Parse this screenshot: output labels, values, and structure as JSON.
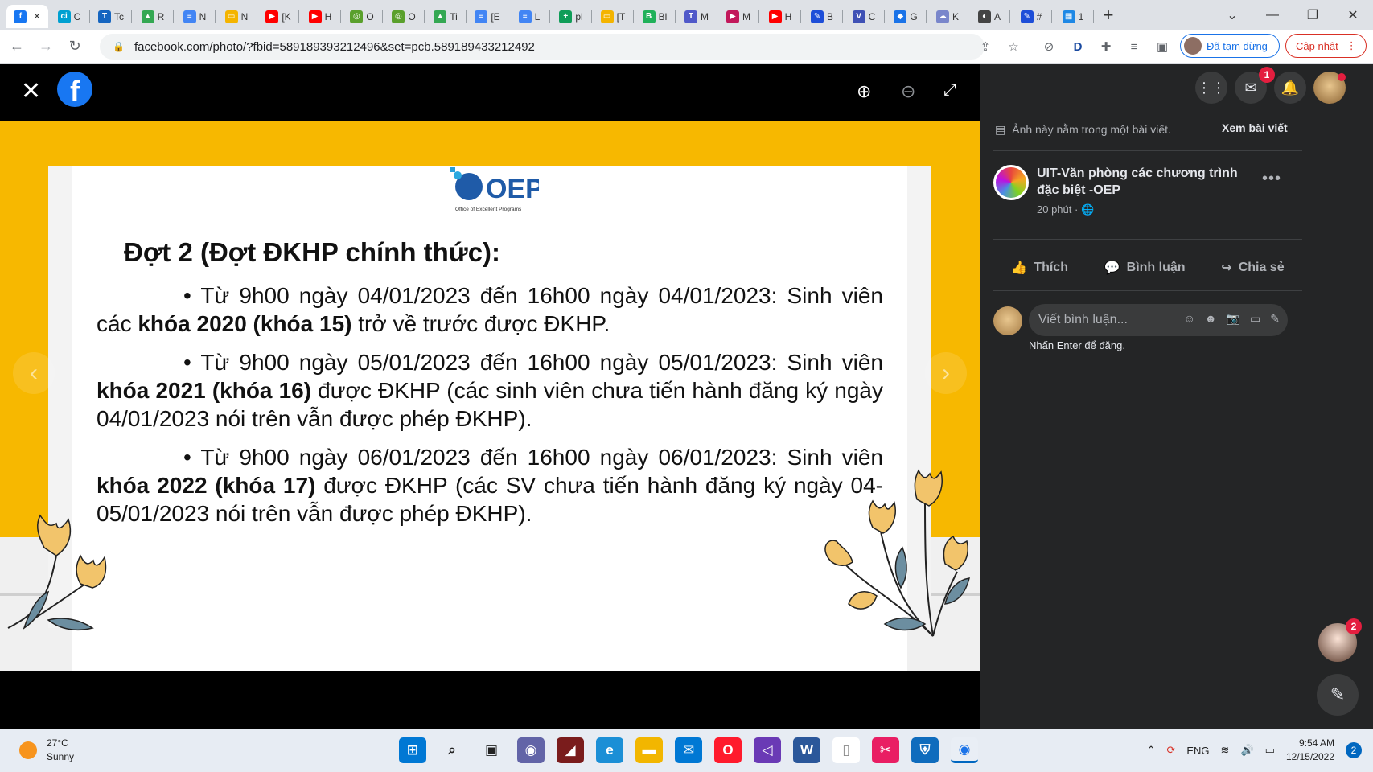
{
  "browser": {
    "tabs": [
      {
        "label": "",
        "color": "#1877f2",
        "glyph": "f",
        "active": true
      },
      {
        "label": "C",
        "color": "#00a0d1",
        "glyph": "ci"
      },
      {
        "label": "Tc",
        "color": "#1565c0",
        "glyph": "T"
      },
      {
        "label": "R",
        "color": "#34a853",
        "glyph": "▲"
      },
      {
        "label": "N",
        "color": "#4285f4",
        "glyph": "≡"
      },
      {
        "label": "N",
        "color": "#f4b400",
        "glyph": "▭"
      },
      {
        "label": "[K",
        "color": "#ff0000",
        "glyph": "▶"
      },
      {
        "label": "H",
        "color": "#ff0000",
        "glyph": "▶"
      },
      {
        "label": "O",
        "color": "#5aa02c",
        "glyph": "◎"
      },
      {
        "label": "O",
        "color": "#5aa02c",
        "glyph": "◎"
      },
      {
        "label": "Ti",
        "color": "#34a853",
        "glyph": "▲"
      },
      {
        "label": "[E",
        "color": "#4285f4",
        "glyph": "≡"
      },
      {
        "label": "L",
        "color": "#4285f4",
        "glyph": "≡"
      },
      {
        "label": "pl",
        "color": "#0f9d58",
        "glyph": "+"
      },
      {
        "label": "[T",
        "color": "#f4b400",
        "glyph": "▭"
      },
      {
        "label": "Bl",
        "color": "#20b15a",
        "glyph": "B"
      },
      {
        "label": "M",
        "color": "#5059c9",
        "glyph": "T"
      },
      {
        "label": "M",
        "color": "#c2185b",
        "glyph": "▶"
      },
      {
        "label": "H",
        "color": "#ff0000",
        "glyph": "▶"
      },
      {
        "label": "B",
        "color": "#1d4ed8",
        "glyph": "✎"
      },
      {
        "label": "C",
        "color": "#3f51b5",
        "glyph": "V"
      },
      {
        "label": "G",
        "color": "#1a73e8",
        "glyph": "◆"
      },
      {
        "label": "K",
        "color": "#7986cb",
        "glyph": "☁"
      },
      {
        "label": "A",
        "color": "#444444",
        "glyph": "◐"
      },
      {
        "label": "#",
        "color": "#1d4ed8",
        "glyph": "✎"
      },
      {
        "label": "1",
        "color": "#1e88e5",
        "glyph": "▦"
      }
    ],
    "new_tab": "+",
    "url": "facebook.com/photo/?fbid=589189393212496&set=pcb.589189433212492",
    "profile_status": "Đã tạm dừng",
    "update_label": "Cập nhật"
  },
  "slide": {
    "logo_text": "OEP",
    "logo_sub": "Office of Excellent Programs",
    "heading": "Đợt 2 (Đợt ĐKHP chính thức):",
    "items": [
      {
        "bullet": "•",
        "pre": " Từ 9h00 ngày 04/01/2023 đến 16h00 ngày 04/01/2023: Sinh viên các ",
        "bold": "khóa 2020 (khóa 15)",
        "post": " trở về trước được ĐKHP."
      },
      {
        "bullet": "•",
        "pre": " Từ 9h00 ngày 05/01/2023 đến 16h00 ngày 05/01/2023: Sinh viên ",
        "bold": "khóa 2021 (khóa 16)",
        "post": " được ĐKHP (các sinh viên chưa tiến hành đăng ký ngày 04/01/2023 nói trên vẫn được phép ĐKHP)."
      },
      {
        "bullet": "•",
        "pre": " Từ 9h00 ngày 06/01/2023 đến 16h00 ngày 06/01/2023: Sinh viên ",
        "bold": "khóa 2022 (khóa 17)",
        "post": " được ĐKHP (các SV chưa tiến hành đăng ký ngày 04-05/01/2023 nói trên vẫn được phép ĐKHP)."
      }
    ]
  },
  "panel": {
    "messenger_badge": "1",
    "info": "Ảnh này nằm trong một bài viết.",
    "see_post": "Xem bài viết",
    "page_name": "UIT-Văn phòng các chương trình đặc biệt -OEP",
    "time": "20 phút ·",
    "like": "Thích",
    "comment": "Bình luận",
    "share": "Chia sẻ",
    "comment_placeholder": "Viết bình luận...",
    "hint": "Nhấn Enter để đăng.",
    "chat_badge": "2"
  },
  "taskbar": {
    "temp": "27°C",
    "condition": "Sunny",
    "lang": "ENG",
    "time": "9:54 AM",
    "date": "12/15/2022",
    "notif": "2"
  }
}
